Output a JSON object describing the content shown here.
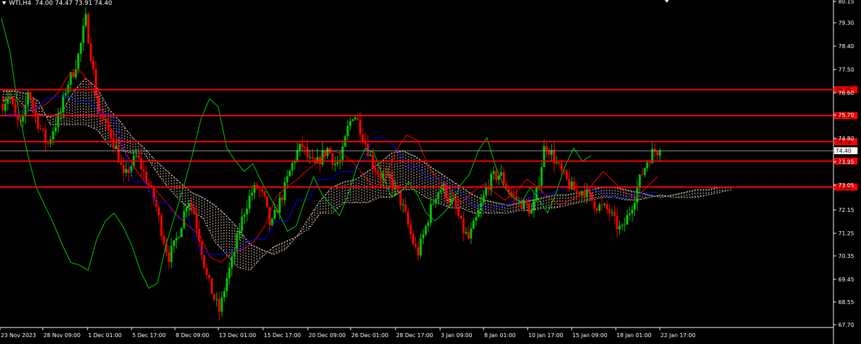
{
  "header": {
    "symbol": "WTI,H4",
    "ohlc": "74.00 74.47 73.91 74.40"
  },
  "colors": {
    "bg": "#000000",
    "bull": "#00c800",
    "bear": "#ff0000",
    "tenkan": "#ff0000",
    "kijun": "#0000ff",
    "chikou": "#00d200",
    "cloud": "#f2dcc8",
    "level": "#ff0000",
    "current": "#c8c8c8"
  },
  "chart_data": {
    "type": "candlestick",
    "ylim": [
      67.7,
      80.15
    ],
    "y_ticks": [
      "80.15",
      "79.30",
      "78.40",
      "77.50",
      "76.60",
      "75.70",
      "74.80",
      "73.95",
      "73.05",
      "72.15",
      "71.25",
      "70.35",
      "69.45",
      "68.55",
      "67.70"
    ],
    "x_ticks": [
      "23 Nov 2023",
      "28 Nov 09:00",
      "1 Dec 01:00",
      "5 Dec 17:00",
      "8 Dec 09:00",
      "13 Dec 01:00",
      "15 Dec 17:00",
      "20 Dec 09:00",
      "26 Dec 01:00",
      "28 Dec 17:00",
      "3 Jan 09:00",
      "8 Jan 01:00",
      "10 Jan 17:00",
      "15 Jan 09:00",
      "18 Jan 01:00",
      "22 Jan 17:00"
    ],
    "horizontal_levels": [
      {
        "value": 76.75,
        "label": "76.75"
      },
      {
        "value": 75.75,
        "label": "75.75"
      },
      {
        "value": 74.75,
        "label": "74.75"
      },
      {
        "value": 74.0,
        "label": "74.00"
      },
      {
        "value": 73.0,
        "label": "73.00"
      }
    ],
    "current_price": {
      "value": 74.4,
      "label": "74.40"
    },
    "close_path": [
      76.2,
      76.6,
      75.6,
      75.3,
      76.8,
      75.8,
      75.2,
      74.6,
      75.3,
      75.8,
      76.9,
      77.4,
      78.2,
      79.5,
      77.8,
      75.9,
      75.4,
      75.0,
      74.3,
      73.3,
      73.8,
      74.2,
      73.6,
      73.0,
      72.3,
      71.2,
      70.3,
      70.8,
      71.6,
      72.6,
      72.0,
      70.8,
      69.5,
      68.8,
      68.2,
      69.4,
      70.2,
      71.3,
      72.2,
      72.8,
      73.0,
      72.5,
      71.4,
      72.2,
      72.8,
      73.6,
      74.3,
      74.6,
      74.0,
      73.8,
      74.2,
      74.5,
      73.9,
      74.0,
      75.2,
      75.9,
      75.3,
      74.6,
      73.9,
      73.5,
      73.3,
      73.2,
      72.7,
      72.0,
      71.1,
      70.4,
      71.2,
      72.1,
      72.8,
      73.0,
      72.5,
      72.2,
      71.4,
      71.0,
      71.6,
      72.3,
      73.1,
      73.4,
      73.5,
      73.0,
      72.6,
      72.4,
      72.3,
      72.0,
      73.2,
      74.7,
      74.3,
      73.8,
      73.4,
      73.0,
      72.8,
      72.9,
      72.6,
      72.3,
      72.2,
      72.1,
      71.6,
      71.3,
      71.9,
      72.6,
      73.4,
      74.0,
      74.4,
      74.4
    ],
    "series": [
      {
        "name": "Tenkan-sen",
        "values": [
          76.4,
          76.4,
          76.0,
          76.0,
          76.2,
          76.6,
          77.3,
          77.5,
          77.0,
          76.0,
          75.2,
          74.5,
          73.8,
          73.2,
          72.9,
          72.4,
          71.9,
          71.5,
          71.2,
          70.3,
          70.1,
          70.5,
          70.6,
          70.9,
          71.5,
          72.6,
          73.0,
          73.3,
          73.7,
          74.0,
          74.4,
          74.3,
          74.0,
          73.5,
          73.0,
          73.3,
          74.4,
          75.0,
          74.8,
          73.8,
          73.2,
          72.9,
          72.4,
          72.8,
          73.1,
          72.8,
          72.5,
          72.8,
          73.3,
          73.0,
          72.6,
          72.3,
          72.5,
          72.7,
          73.1,
          73.6,
          73.2,
          72.8,
          72.6,
          73.0,
          73.4
        ]
      },
      {
        "name": "Kijun-sen",
        "values": [
          75.8,
          75.8,
          76.0,
          76.0,
          76.4,
          76.5,
          76.5,
          76.3,
          76.3,
          75.8,
          75.8,
          74.6,
          73.2,
          73.2,
          72.4,
          72.4,
          71.8,
          71.8,
          70.6,
          70.4,
          70.4,
          70.5,
          70.7,
          71.0,
          71.0,
          71.7,
          71.7,
          72.5,
          72.5,
          73.3,
          73.3,
          73.6,
          73.6,
          74.0,
          74.9,
          74.9,
          74.5,
          73.8,
          73.8,
          73.3,
          73.3,
          73.0,
          72.8,
          72.3,
          72.2,
          72.2,
          72.3,
          72.5,
          72.5,
          72.8,
          72.7,
          72.9,
          73.0,
          73.0,
          72.9,
          72.8,
          72.6,
          72.6,
          72.7,
          72.8,
          72.8
        ]
      },
      {
        "name": "Chikou Span",
        "values": [
          79.5,
          78.2,
          75.9,
          74.3,
          73.0,
          72.3,
          71.6,
          70.8,
          70.1,
          70.0,
          69.8,
          71.0,
          71.7,
          72.0,
          71.5,
          70.8,
          69.8,
          69.1,
          69.3,
          70.8,
          71.9,
          73.0,
          74.2,
          75.6,
          76.4,
          76.1,
          74.5,
          74.0,
          73.6,
          73.9,
          73.2,
          72.6,
          72.0,
          71.3,
          71.5,
          72.5,
          73.4,
          72.7,
          72.3,
          71.9,
          72.7,
          73.8,
          74.5,
          74.3,
          73.4,
          72.6,
          72.8,
          73.2,
          72.7,
          72.0,
          71.7,
          72.0,
          72.4,
          73.1,
          73.5,
          74.4,
          74.9,
          73.8,
          73.0,
          72.6,
          72.4,
          73.0,
          72.5,
          72.0,
          72.8,
          73.8,
          74.5,
          74.0,
          74.2
        ]
      },
      {
        "name": "Senkou A",
        "values": [
          76.3,
          76.5,
          76.0,
          75.8,
          75.7,
          75.9,
          76.7,
          77.2,
          76.8,
          76.0,
          75.5,
          74.9,
          74.5,
          74.0,
          73.6,
          73.2,
          72.8,
          72.6,
          72.3,
          71.9,
          71.4,
          70.8,
          70.6,
          70.4,
          70.6,
          71.1,
          71.8,
          72.5,
          73.0,
          73.2,
          73.3,
          73.6,
          73.9,
          74.3,
          74.4,
          74.2,
          73.9,
          73.6,
          73.3,
          73.0,
          72.7,
          72.5,
          72.4,
          72.3,
          72.4,
          72.5,
          72.6,
          72.7,
          72.7,
          72.8,
          72.9,
          73.0,
          73.0,
          72.9,
          72.8,
          72.7,
          72.6,
          72.7,
          72.8,
          72.9,
          72.9,
          73.0,
          73.0
        ]
      },
      {
        "name": "Senkou B",
        "values": [
          76.7,
          76.7,
          76.6,
          76.3,
          75.4,
          75.4,
          75.4,
          75.4,
          75.2,
          74.6,
          74.4,
          74.3,
          74.3,
          73.6,
          73.0,
          72.5,
          72.1,
          71.8,
          70.9,
          70.4,
          69.9,
          69.8,
          70.3,
          70.7,
          70.9,
          71.1,
          71.4,
          72.0,
          72.0,
          72.4,
          72.4,
          72.4,
          72.6,
          72.6,
          72.9,
          72.9,
          72.6,
          72.4,
          72.2,
          72.2,
          72.0,
          72.0,
          72.0,
          72.0,
          72.1,
          72.1,
          72.2,
          72.2,
          72.3,
          72.4,
          72.5,
          72.6,
          72.6,
          72.5,
          72.5,
          72.6,
          72.7,
          72.6,
          72.6,
          72.6,
          72.7,
          72.8,
          72.9
        ]
      }
    ]
  }
}
